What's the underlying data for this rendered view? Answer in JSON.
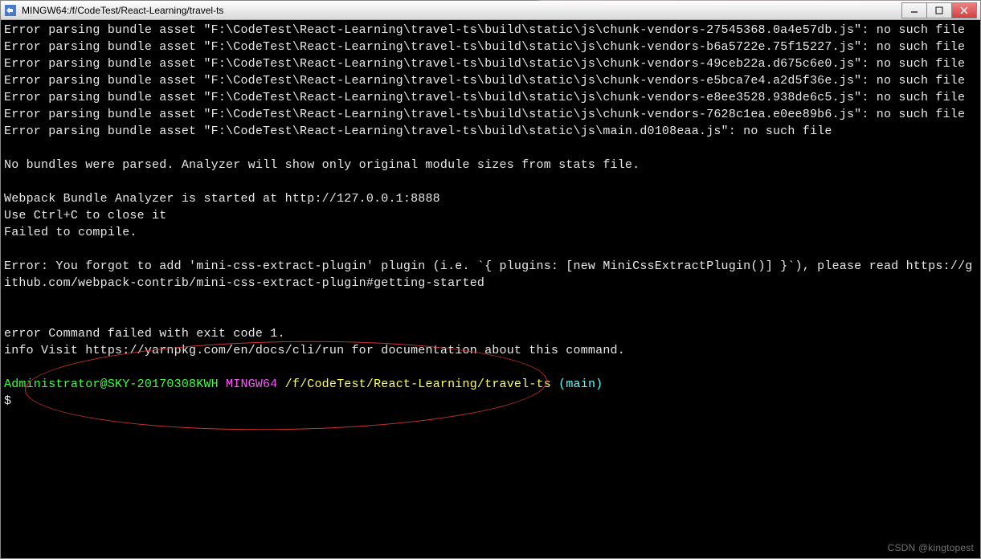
{
  "window": {
    "title": "MINGW64:/f/CodeTest/React-Learning/travel-ts"
  },
  "terminal": {
    "errors": [
      "Error parsing bundle asset \"F:\\CodeTest\\React-Learning\\travel-ts\\build\\static\\js\\chunk-vendors-27545368.0a4e57db.js\": no such file",
      "Error parsing bundle asset \"F:\\CodeTest\\React-Learning\\travel-ts\\build\\static\\js\\chunk-vendors-b6a5722e.75f15227.js\": no such file",
      "Error parsing bundle asset \"F:\\CodeTest\\React-Learning\\travel-ts\\build\\static\\js\\chunk-vendors-49ceb22a.d675c6e0.js\": no such file",
      "Error parsing bundle asset \"F:\\CodeTest\\React-Learning\\travel-ts\\build\\static\\js\\chunk-vendors-e5bca7e4.a2d5f36e.js\": no such file",
      "Error parsing bundle asset \"F:\\CodeTest\\React-Learning\\travel-ts\\build\\static\\js\\chunk-vendors-e8ee3528.938de6c5.js\": no such file",
      "Error parsing bundle asset \"F:\\CodeTest\\React-Learning\\travel-ts\\build\\static\\js\\chunk-vendors-7628c1ea.e0ee89b6.js\": no such file",
      "Error parsing bundle asset \"F:\\CodeTest\\React-Learning\\travel-ts\\build\\static\\js\\main.d0108eaa.js\": no such file"
    ],
    "noBundles": "No bundles were parsed. Analyzer will show only original module sizes from stats file.",
    "analyzerStarted": "Webpack Bundle Analyzer is started at http://127.0.0.1:8888",
    "ctrlC": "Use Ctrl+C to close it",
    "failedCompile": "Failed to compile.",
    "forgotPlugin": "Error: You forgot to add 'mini-css-extract-plugin' plugin (i.e. `{ plugins: [new MiniCssExtractPlugin()] }`), please read https://github.com/webpack-contrib/mini-css-extract-plugin#getting-started",
    "commandFailed": "error Command failed with exit code 1.",
    "infoVisit": "info Visit https://yarnpkg.com/en/docs/cli/run for documentation about this command.",
    "prompt": {
      "user": "Administrator@SKY-20170308KWH",
      "host": "MINGW64",
      "path": "/f/CodeTest/React-Learning/travel-ts",
      "branch": "(main)"
    },
    "promptSymbol": "$"
  },
  "watermark": "CSDN @kingtopest"
}
